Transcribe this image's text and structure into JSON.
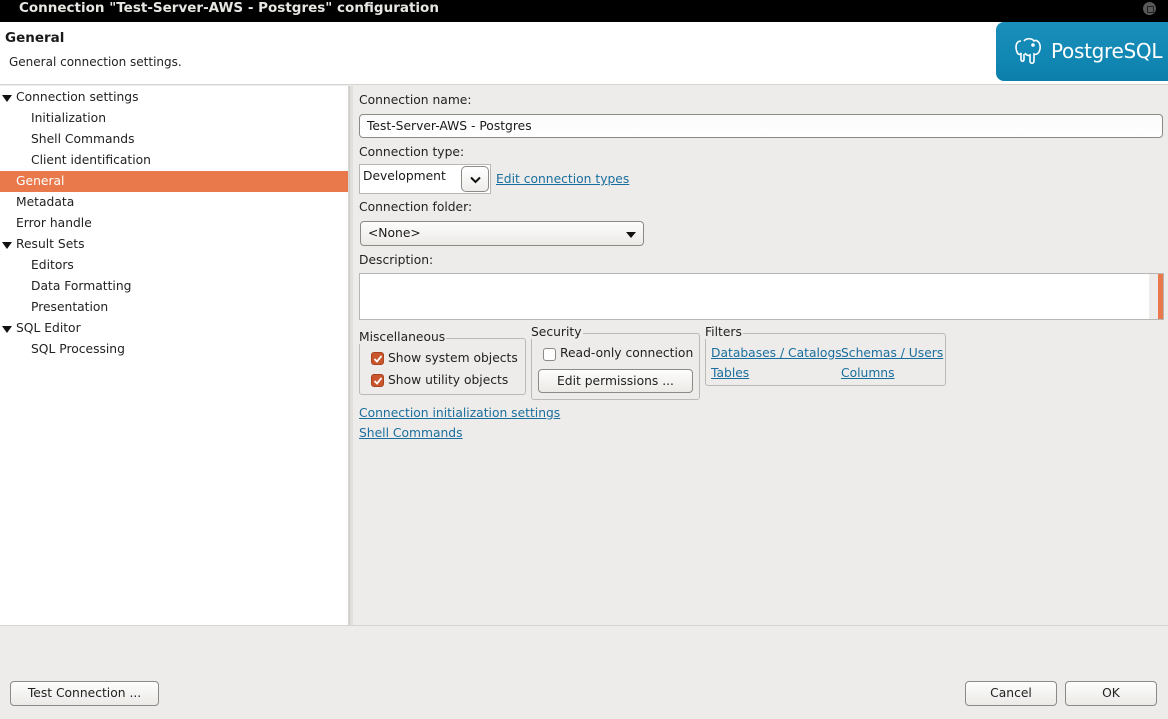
{
  "window": {
    "title": "Connection \"Test-Server-AWS - Postgres\" configuration"
  },
  "header": {
    "title": "General",
    "description": "General connection settings.",
    "logo_text": "PostgreSQL",
    "logo_icon": "postgresql-elephant-icon"
  },
  "tree": {
    "items": [
      {
        "label": "Connection settings",
        "level": 0,
        "expanded": true
      },
      {
        "label": "Initialization",
        "level": 1
      },
      {
        "label": "Shell Commands",
        "level": 1
      },
      {
        "label": "Client identification",
        "level": 1
      },
      {
        "label": "General",
        "level": 0,
        "selected": true
      },
      {
        "label": "Metadata",
        "level": 0
      },
      {
        "label": "Error handle",
        "level": 0
      },
      {
        "label": "Result Sets",
        "level": 0,
        "expanded": true
      },
      {
        "label": "Editors",
        "level": 1
      },
      {
        "label": "Data Formatting",
        "level": 1
      },
      {
        "label": "Presentation",
        "level": 1
      },
      {
        "label": "SQL Editor",
        "level": 0,
        "expanded": true
      },
      {
        "label": "SQL Processing",
        "level": 1
      }
    ]
  },
  "form": {
    "connection_name_label": "Connection name:",
    "connection_name_value": "Test-Server-AWS - Postgres",
    "connection_type_label": "Connection type:",
    "connection_type_value": "Development",
    "edit_connection_types_link": "Edit connection types",
    "connection_folder_label": "Connection folder:",
    "connection_folder_value": "<None>",
    "description_label": "Description:",
    "description_value": ""
  },
  "misc": {
    "title": "Miscellaneous",
    "show_system_objects": {
      "label": "Show system objects",
      "checked": true
    },
    "show_utility_objects": {
      "label": "Show utility objects",
      "checked": true
    }
  },
  "security": {
    "title": "Security",
    "read_only": {
      "label": "Read-only connection",
      "checked": false
    },
    "edit_permissions_button": "Edit permissions ..."
  },
  "filters": {
    "title": "Filters",
    "links": [
      "Databases / Catalogs",
      "Schemas / Users",
      "Tables",
      "Columns"
    ]
  },
  "links": {
    "init_settings": "Connection initialization settings",
    "shell_commands": "Shell Commands"
  },
  "buttons": {
    "test_connection": "Test Connection ...",
    "cancel": "Cancel",
    "ok": "OK"
  },
  "colors": {
    "accent": "#e9784a",
    "link": "#1a6e9e",
    "logo_bg": "#1187b3"
  }
}
